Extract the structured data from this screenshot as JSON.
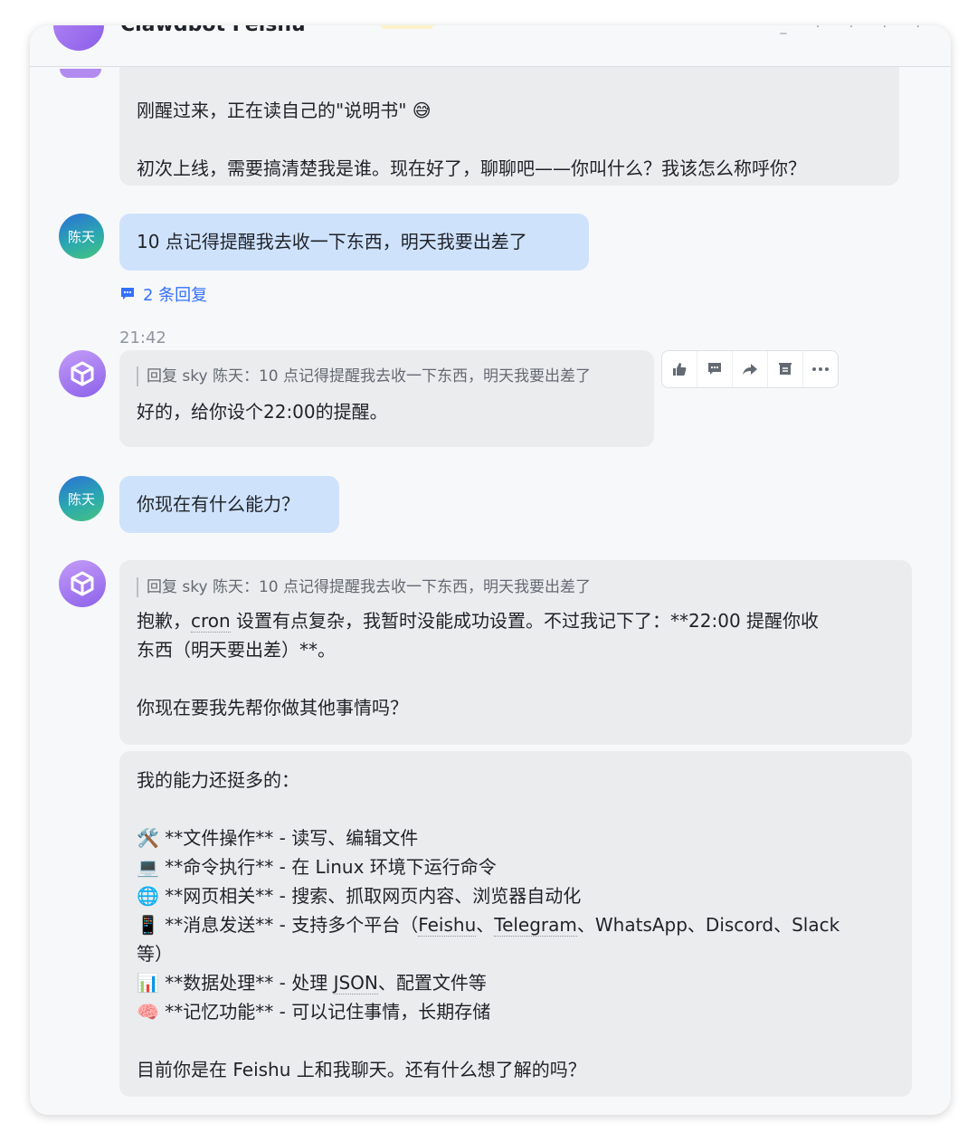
{
  "header": {
    "title": "Clawdbot Feishu"
  },
  "messages": [
    {
      "lines": [
        "刚醒过来，正在读自己的\"说明书\" 😅",
        "",
        "初次上线，需要搞清楚我是谁。现在好了，聊聊吧——你叫什么？我该怎么称呼你？"
      ]
    },
    {
      "avatar": "陈天",
      "text": "10 点记得提醒我去收一下东西，明天我要出差了",
      "replies": "2 条回复"
    },
    {
      "time": "21:42",
      "quote": "回复 sky 陈天：10 点记得提醒我去收一下东西，明天我要出差了",
      "text": "好的，给你设个22:00的提醒。"
    },
    {
      "avatar": "陈天",
      "text": "你现在有什么能力？"
    },
    {
      "quote": "回复 sky 陈天：10 点记得提醒我去收一下东西，明天我要出差了",
      "p1_a": "抱歉，",
      "p1_cron": "cron",
      "p1_b": " 设置有点复杂，我暂时没能成功设置。不过我记下了：**22:00 提醒你收",
      "p1_c": "东西（明天要出差）**。",
      "p2": "你现在要我先帮你做其他事情吗？"
    },
    {
      "intro": "我的能力还挺多的：",
      "items": [
        {
          "emoji": "🛠️",
          "text": "**文件操作** - 读写、编辑文件"
        },
        {
          "emoji": "💻",
          "text": "**命令执行** - 在 Linux 环境下运行命令"
        },
        {
          "emoji": "🌐",
          "text": "**网页相关** - 搜索、抓取网页内容、浏览器自动化"
        },
        {
          "emoji": "📱",
          "text_a": "**消息发送** - 支持多个平台（",
          "feishu": "Feishu",
          "sep1": "、",
          "telegram": "Telegram",
          "text_b": "、WhatsApp、Discord、Slack",
          "text_c": "等）"
        },
        {
          "emoji": "📊",
          "text_a": "**数据处理** - 处理 ",
          "json": "JSON",
          "text_b": "、配置文件等"
        },
        {
          "emoji": "🧠",
          "text": "**记忆功能** - 可以记住事情，长期存储"
        }
      ],
      "outro": "目前你是在 Feishu 上和我聊天。还有什么想了解的吗？"
    }
  ],
  "icons": {
    "thumbs_up": "thumbs-up-icon",
    "reply": "reply-icon",
    "forward": "forward-icon",
    "pin": "pin-icon",
    "more": "more-icon",
    "comment": "comment-icon",
    "bot_cube": "cube-icon"
  },
  "colors": {
    "bot_bubble": "#ebecee",
    "user_bubble": "#cfe2fc",
    "link": "#3370ff",
    "bot_avatar": "#9b6ef0"
  }
}
